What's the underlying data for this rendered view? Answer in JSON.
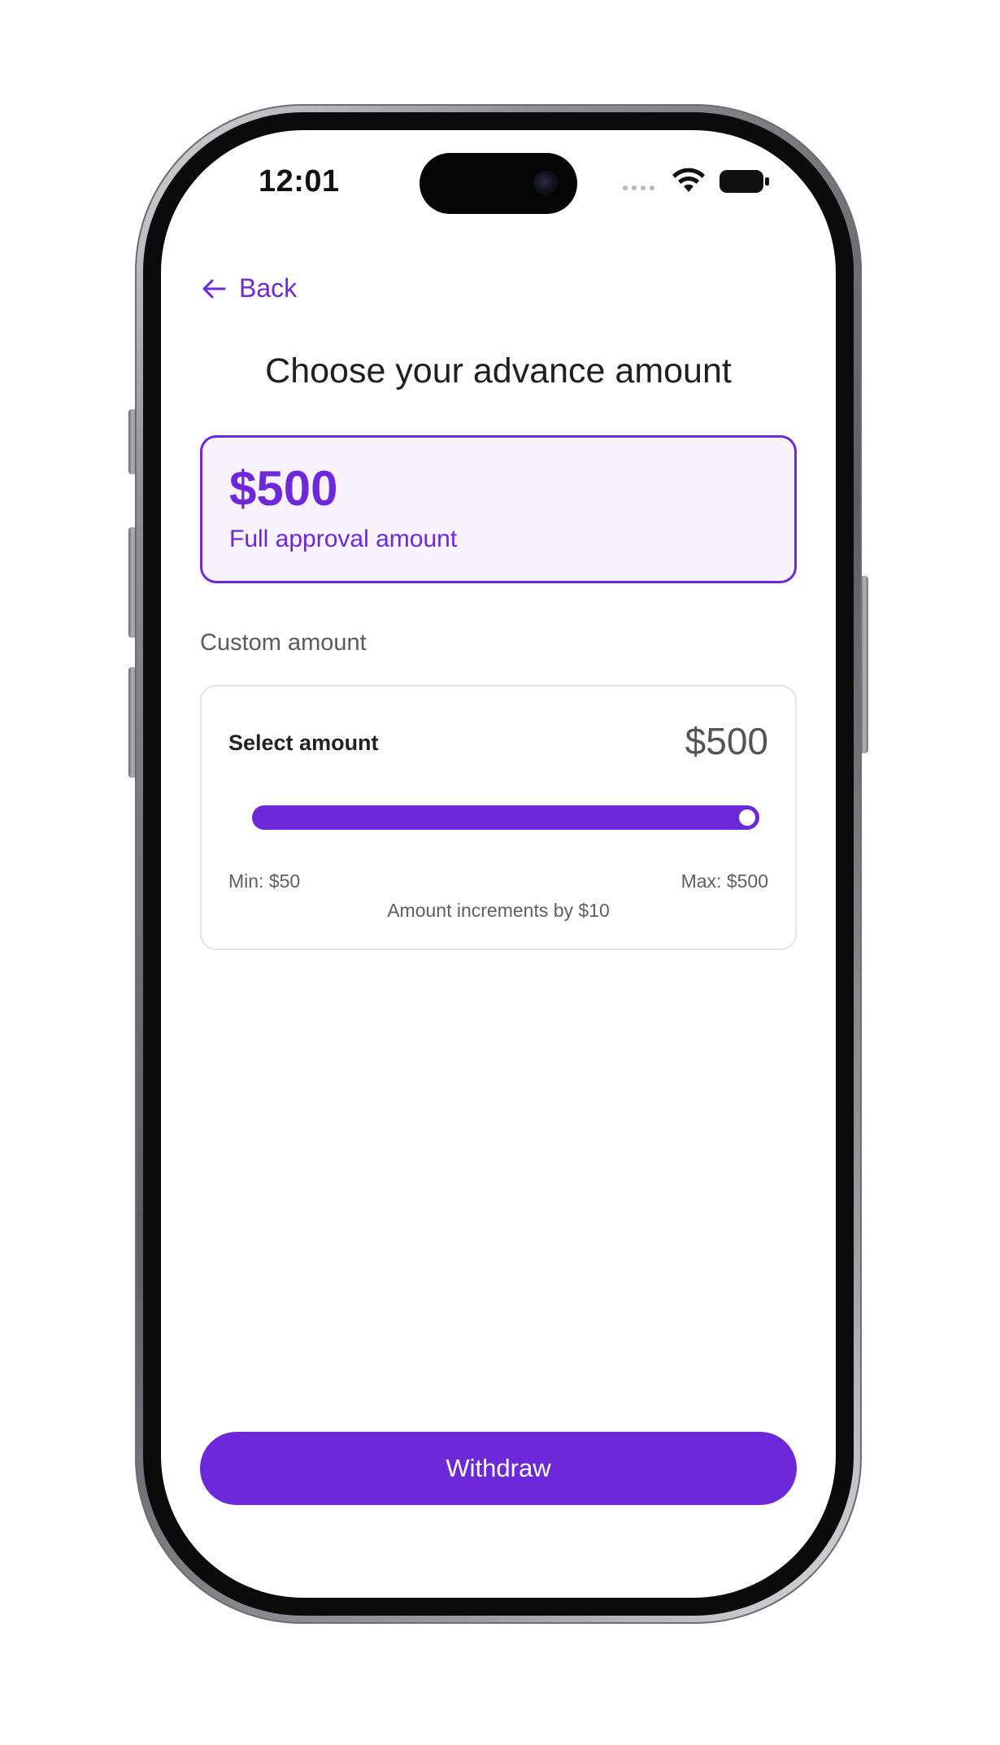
{
  "status_bar": {
    "time": "12:01",
    "icons": [
      "signal-dots-icon",
      "wifi-icon",
      "battery-icon"
    ]
  },
  "header": {
    "back_label": "Back",
    "back_icon": "arrow-left-icon",
    "title": "Choose your advance amount"
  },
  "approval_option": {
    "amount": "$500",
    "label": "Full approval amount",
    "selected": true
  },
  "custom_amount": {
    "section_label": "Custom amount",
    "select_label": "Select amount",
    "selected_value": "$500",
    "slider_fraction": 1.0,
    "min_label": "Min: $50",
    "max_label": "Max: $500",
    "increment_note": "Amount increments by $10"
  },
  "footer": {
    "withdraw_label": "Withdraw"
  },
  "colors": {
    "accent": "#6d28d9",
    "accent_tint": "#f8f2fd",
    "text_primary": "#1f1f1f",
    "text_secondary": "#5a5a5a"
  }
}
